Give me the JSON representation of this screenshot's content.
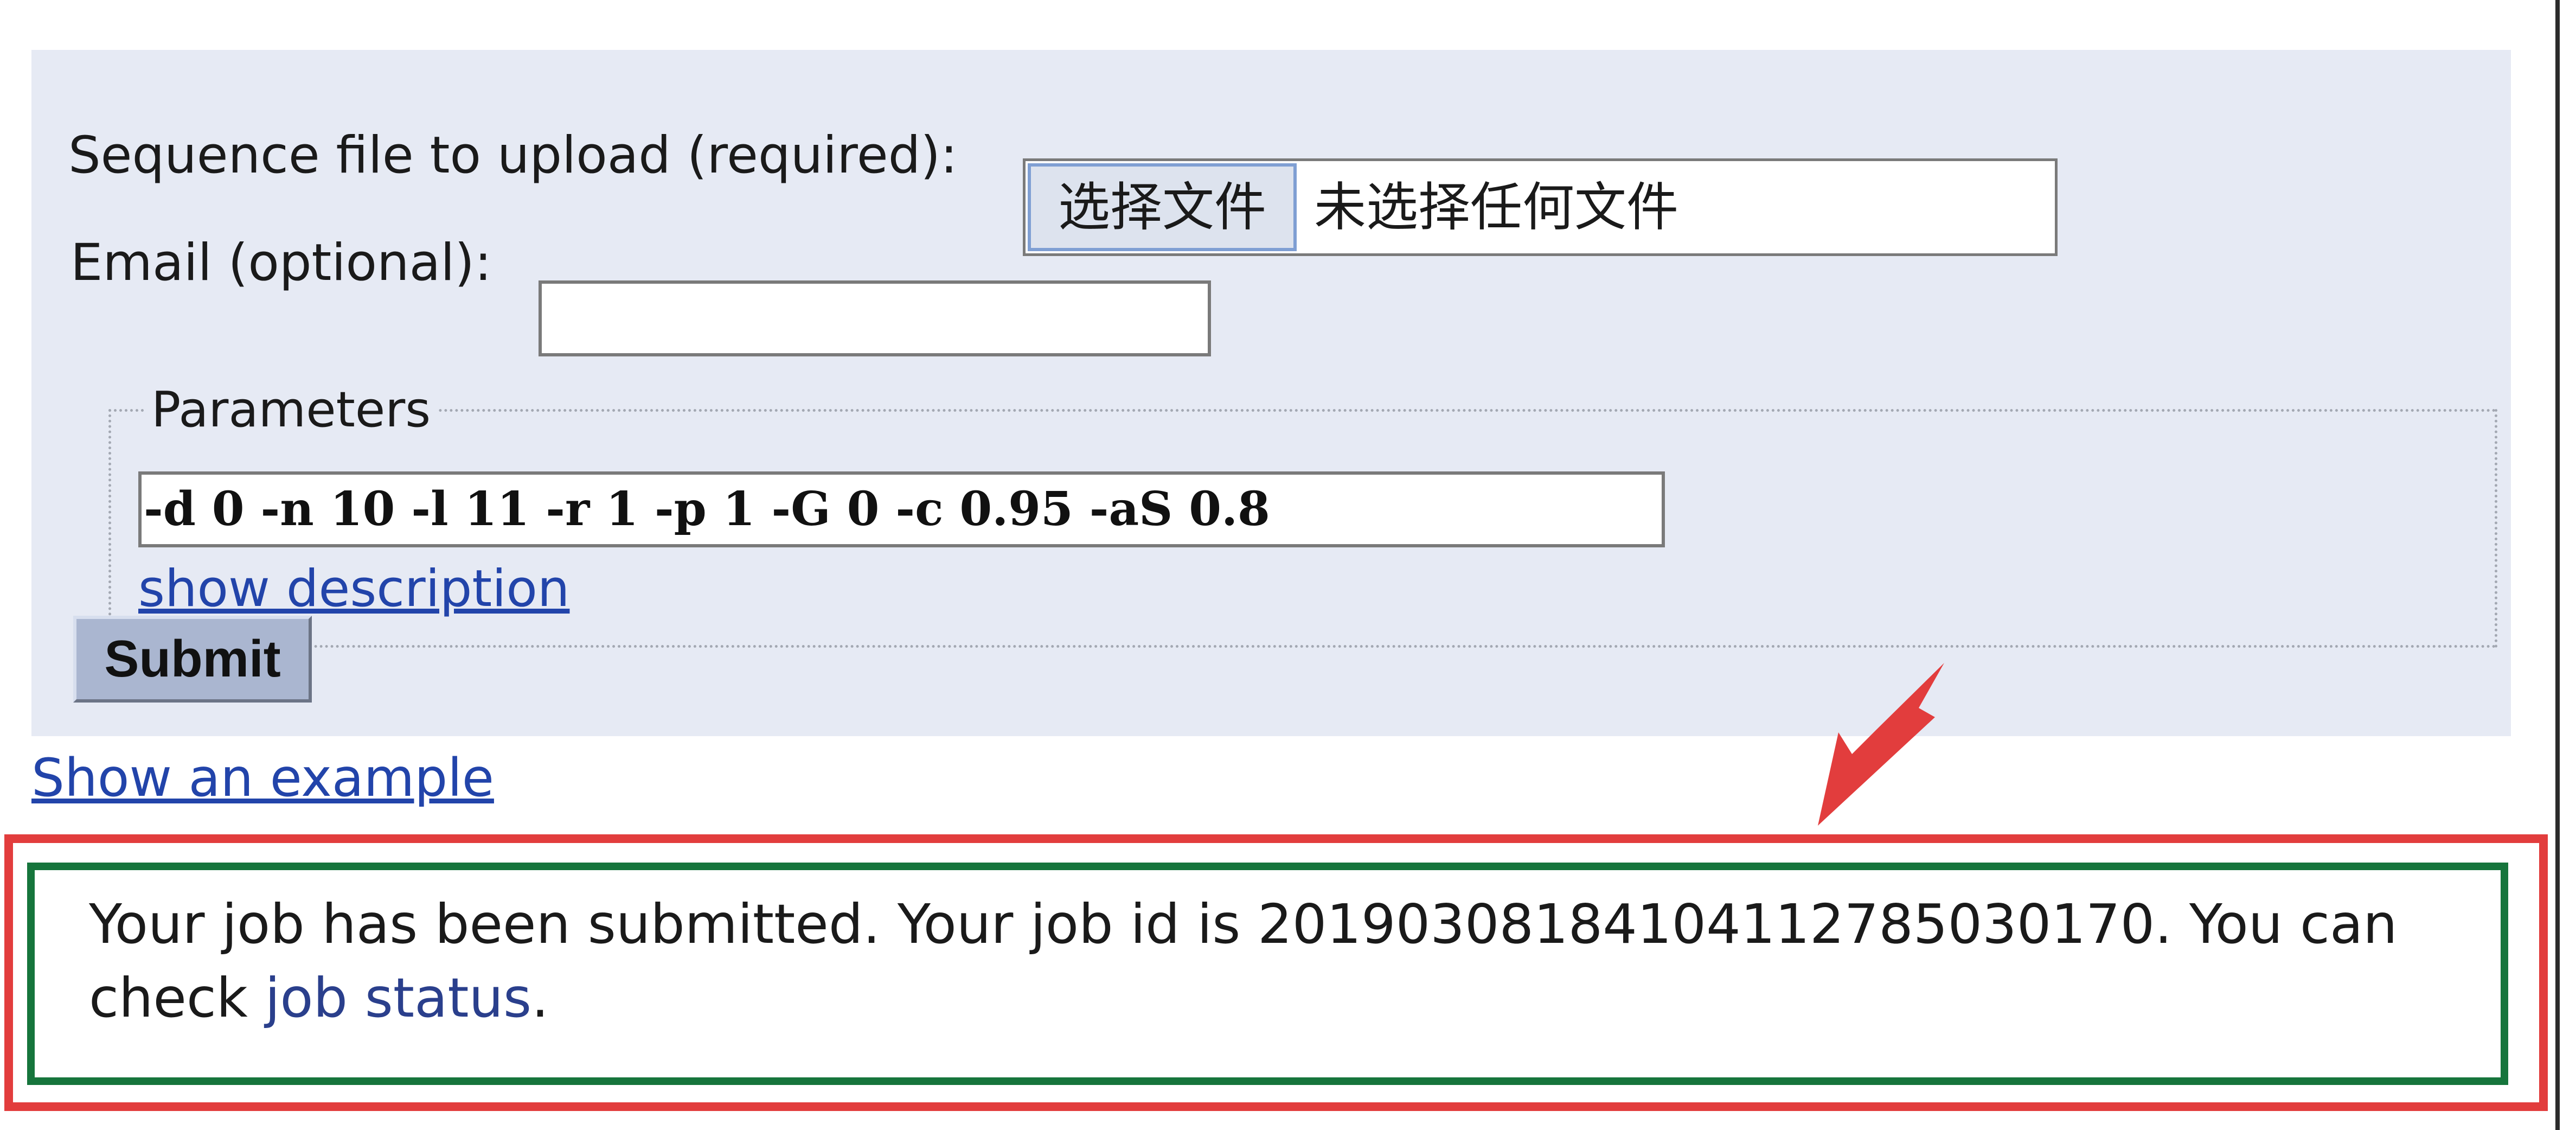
{
  "form": {
    "sequence_label": "Sequence file to upload (required):",
    "file_button_label": "选择文件",
    "file_status_text": "未选择任何文件",
    "email_label": "Email (optional):",
    "email_value": "",
    "parameters_legend": "Parameters",
    "parameters_value": "-d 0 -n 10 -l 11 -r 1 -p 1 -G 0 -c 0.95 -aS 0.8",
    "show_description_label": "show description",
    "submit_label": "Submit"
  },
  "show_example_label": "Show an example",
  "result": {
    "message_text": "Your job has been submitted. Your job id is 20190308184104112785030170. You can check ",
    "job_status_link": "job status",
    "message_end": "."
  },
  "colors": {
    "panel_bg": "#e6eaf4",
    "link": "#2244aa",
    "highlight_frame": "#e23d3d",
    "result_border": "#16753c",
    "arrow": "#e23d3d"
  },
  "icons": {
    "annotation_arrow": "arrow-pointing-down-left"
  }
}
